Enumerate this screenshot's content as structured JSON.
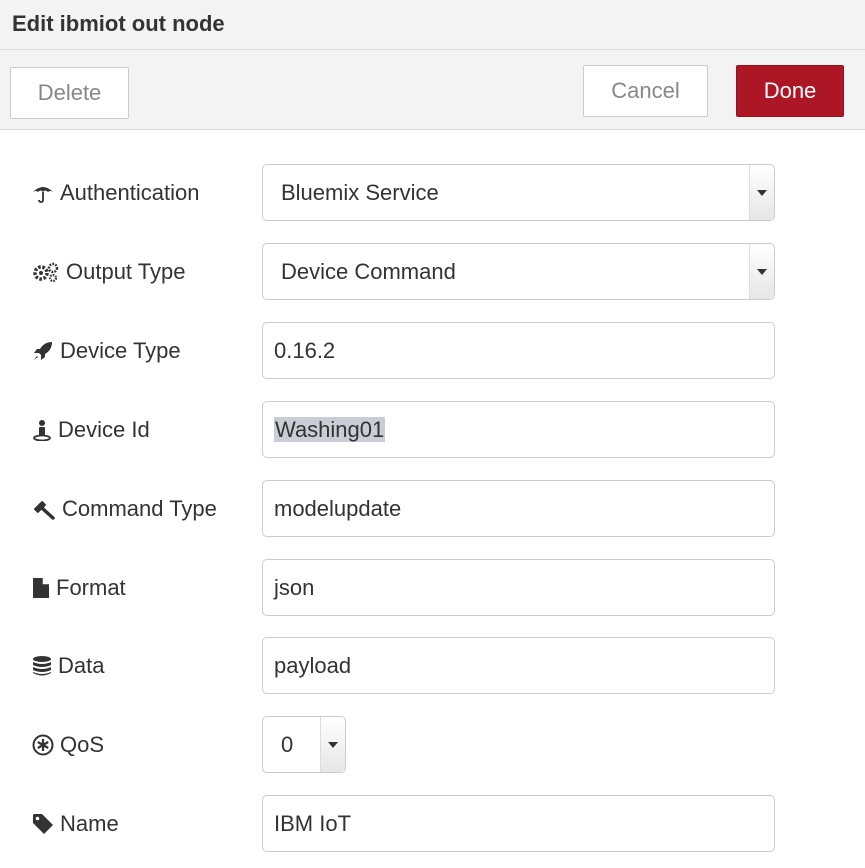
{
  "dialog": {
    "title": "Edit ibmiot out node"
  },
  "toolbar": {
    "delete_label": "Delete",
    "cancel_label": "Cancel",
    "done_label": "Done"
  },
  "colors": {
    "accent": "#ad1625",
    "background": "#f3f3f3"
  },
  "form": {
    "authentication": {
      "label": "Authentication",
      "icon": "umbrella-icon",
      "value": "Bluemix Service"
    },
    "output_type": {
      "label": "Output Type",
      "icon": "cogs-icon",
      "value": "Device Command"
    },
    "device_type": {
      "label": "Device Type",
      "icon": "rocket-icon",
      "value": "0.16.2"
    },
    "device_id": {
      "label": "Device Id",
      "icon": "street-view-icon",
      "value": "Washing01"
    },
    "command_type": {
      "label": "Command Type",
      "icon": "gavel-icon",
      "value": "modelupdate"
    },
    "format": {
      "label": "Format",
      "icon": "file-icon",
      "value": "json"
    },
    "data": {
      "label": "Data",
      "icon": "database-icon",
      "value": "payload"
    },
    "qos": {
      "label": "QoS",
      "icon": "asterisk-circle-icon",
      "value": "0"
    },
    "name": {
      "label": "Name",
      "icon": "tag-icon",
      "value": "IBM IoT"
    }
  }
}
